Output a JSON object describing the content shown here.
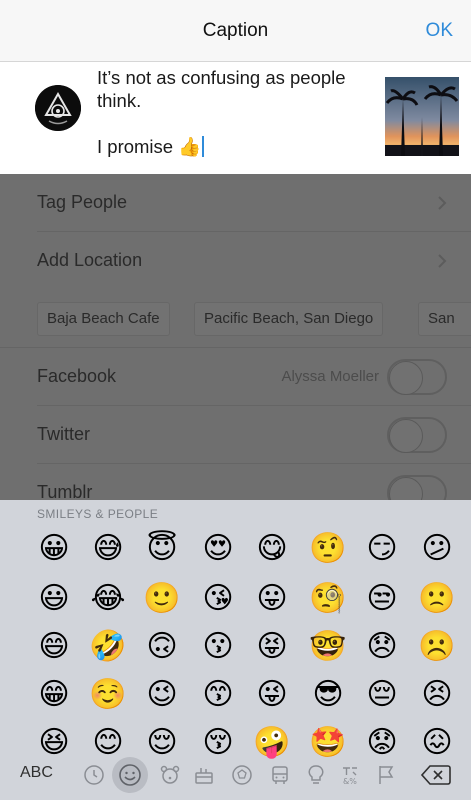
{
  "nav": {
    "title": "Caption",
    "ok_label": "OK"
  },
  "caption": {
    "line1": "It’s not as confusing as people",
    "line2": "think.",
    "line3": "I promise 👍"
  },
  "settings": {
    "tag_people": "Tag People",
    "add_location": "Add Location",
    "location_suggestions": [
      "Baja Beach Cafe",
      "Pacific Beach, San Diego",
      "San"
    ],
    "facebook": {
      "label": "Facebook",
      "account": "Alyssa Moeller"
    },
    "twitter": {
      "label": "Twitter"
    },
    "tumblr": {
      "label": "Tumblr"
    }
  },
  "keyboard": {
    "section_title": "SMILEYS & PEOPLE",
    "abc_label": "ABC",
    "emoji_rows": [
      [
        "😀",
        "😅",
        "😇",
        "😍",
        "😋",
        "🤨",
        "😏",
        "😕"
      ],
      [
        "😃",
        "😂",
        "🙂",
        "😘",
        "😛",
        "🧐",
        "😒",
        "🙁"
      ],
      [
        "😄",
        "🤣",
        "🙃",
        "😗",
        "😝",
        "🤓",
        "😞",
        "☹️"
      ],
      [
        "😁",
        "☺️",
        "😉",
        "😙",
        "😜",
        "😎",
        "😔",
        "😣"
      ],
      [
        "😆",
        "😊",
        "😌",
        "😚",
        "🤪",
        "🤩",
        "😟",
        "😖"
      ]
    ],
    "categories": [
      "clock-icon",
      "smiley-icon",
      "animal-icon",
      "food-icon",
      "ball-icon",
      "car-icon",
      "bulb-icon",
      "symbols-icon",
      "flag-icon"
    ]
  },
  "colors": {
    "accent": "#2f8bd9",
    "emoji_yellow": "#f7c531"
  }
}
